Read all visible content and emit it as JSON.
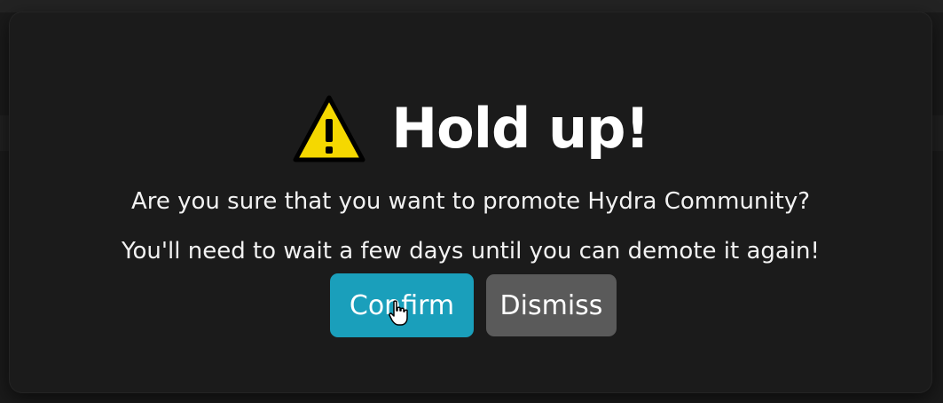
{
  "dialog": {
    "title": "Hold up!",
    "warning_icon": "warning-triangle-icon",
    "message_line1": "Are you sure that you want to promote Hydra Community?",
    "message_line2": "You'll need to wait a few days until you can demote it again!",
    "confirm_label": "Confirm",
    "dismiss_label": "Dismiss",
    "cursor_icon": "hand-pointer-icon"
  },
  "colors": {
    "modal_background": "#1b1b1b",
    "confirm_button": "#1a9fbb",
    "dismiss_button": "#5a5a5a",
    "warning_yellow": "#f5d800",
    "text": "#ffffff"
  }
}
